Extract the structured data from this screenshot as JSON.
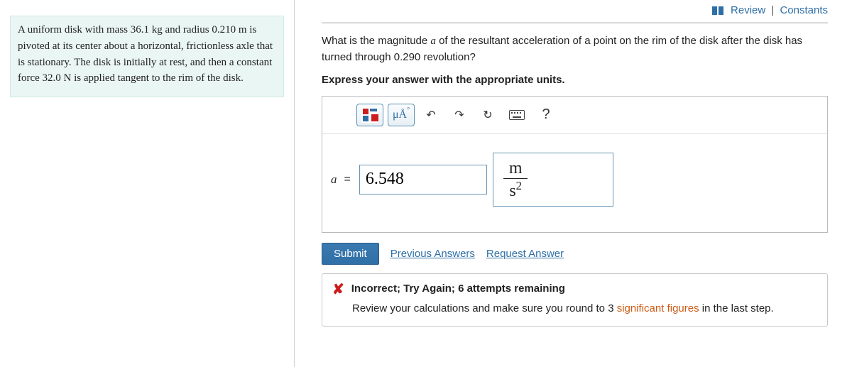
{
  "top_links": {
    "review": "Review",
    "constants": "Constants"
  },
  "problem": {
    "text": "A uniform disk with mass 36.1 kg and radius 0.210 m is pivoted at its center about a horizontal, frictionless axle that is stationary. The disk is initially at rest, and then a constant force 32.0 N is applied tangent to the rim of the disk."
  },
  "question": {
    "prefix": "What is the magnitude ",
    "var": "a",
    "middle": " of the resultant acceleration of a point on the rim of the disk after the disk has turned through 0.290 revolution?",
    "instructions": "Express your answer with the appropriate units."
  },
  "toolbar": {
    "units_btn": "μÅ",
    "help": "?"
  },
  "answer": {
    "var": "a",
    "eq": "=",
    "value": "6.548",
    "units_num": "m",
    "units_den_base": "s",
    "units_den_exp": "2"
  },
  "actions": {
    "submit": "Submit",
    "previous": "Previous Answers",
    "request": "Request Answer"
  },
  "feedback": {
    "headline": "Incorrect; Try Again; 6 attempts remaining",
    "body_pre": "Review your calculations and make sure you round to 3 ",
    "sig_link": "significant figures",
    "body_post": " in the last step."
  }
}
